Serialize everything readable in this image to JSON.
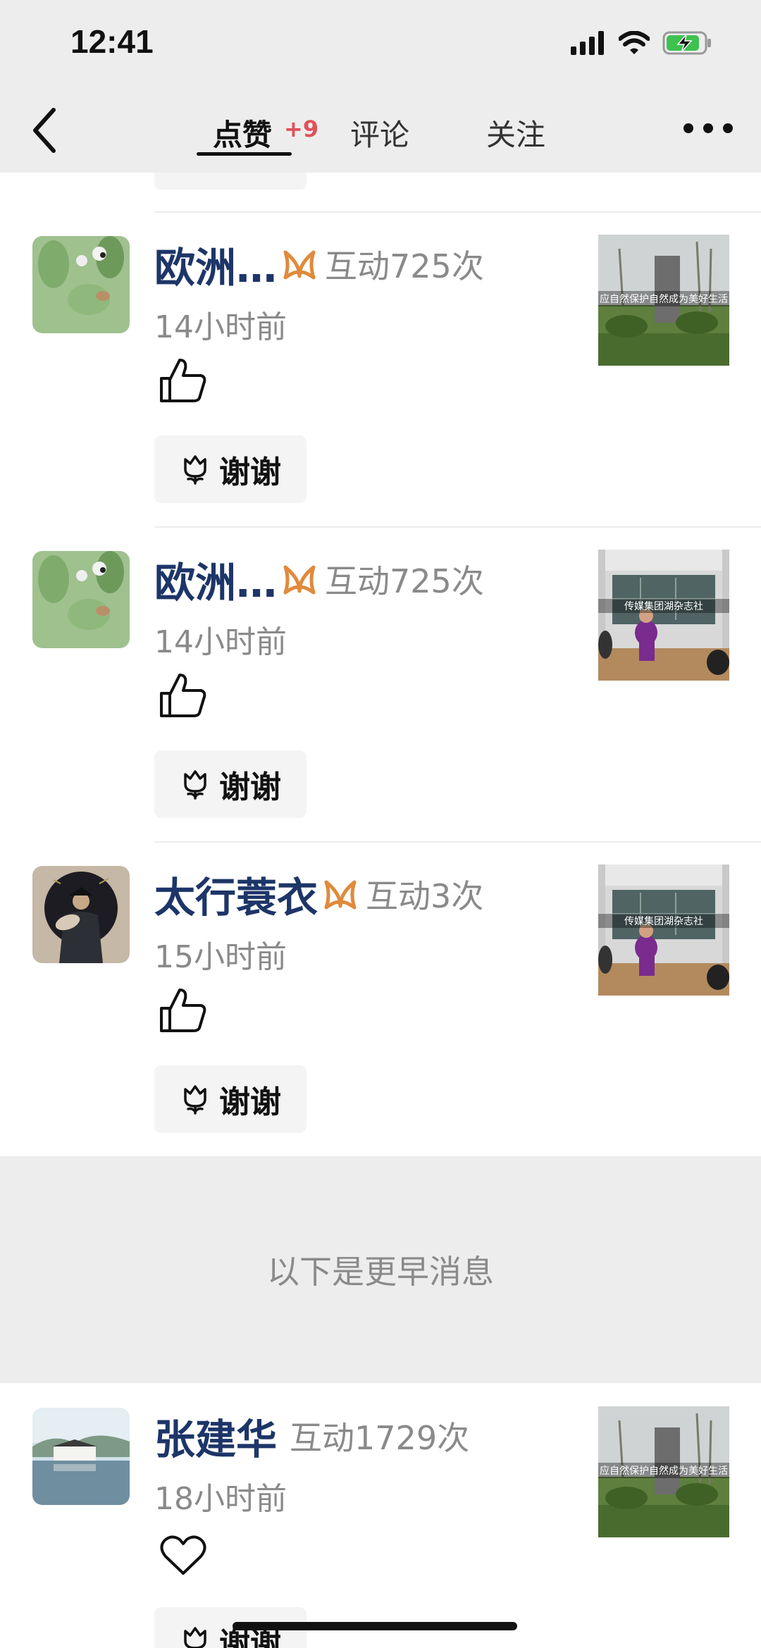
{
  "status_bar": {
    "time": "12:41"
  },
  "nav": {
    "tabs": [
      {
        "label": "点赞",
        "badge": "+9",
        "active": true
      },
      {
        "label": "评论",
        "active": false
      },
      {
        "label": "关注",
        "active": false
      }
    ]
  },
  "notifications": [
    {
      "name": "欧洲…",
      "interaction": "互动725次",
      "time": "14小时前",
      "reaction": "thumbs-up",
      "thanks_label": "谢谢",
      "vip": true,
      "thumb_caption": "应自然保护自然成为美好生活"
    },
    {
      "name": "欧洲…",
      "interaction": "互动725次",
      "time": "14小时前",
      "reaction": "thumbs-up",
      "thanks_label": "谢谢",
      "vip": true,
      "thumb_caption": "传媒集团湖杂志社"
    },
    {
      "name": "太行蓑衣",
      "interaction": "互动3次",
      "time": "15小时前",
      "reaction": "thumbs-up",
      "thanks_label": "谢谢",
      "vip": true,
      "thumb_caption": "传媒集团湖杂志社"
    }
  ],
  "divider": {
    "text": "以下是更早消息"
  },
  "earlier_notifications": [
    {
      "name": "张建华",
      "interaction": "互动1729次",
      "time": "18小时前",
      "reaction": "heart",
      "thanks_label": "谢谢",
      "vip": false,
      "thumb_caption": "应自然保护自然成为美好生活"
    }
  ],
  "colors": {
    "name": "#1d3568",
    "badge": "#e0505a",
    "muted": "#8a8a8a",
    "vip": "#e08a3c"
  }
}
